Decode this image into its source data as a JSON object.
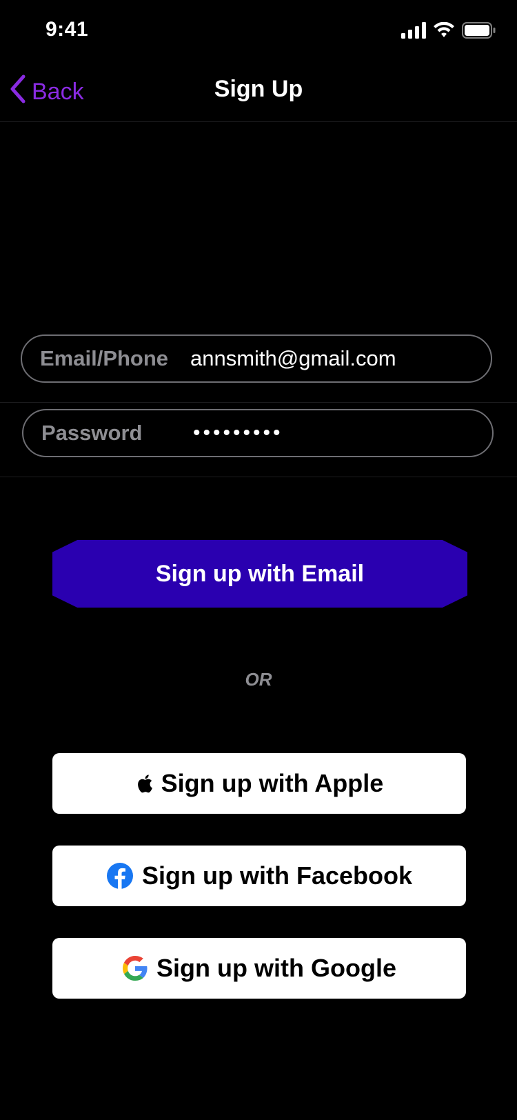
{
  "status_bar": {
    "time": "9:41"
  },
  "nav": {
    "back_label": "Back",
    "title": "Sign Up"
  },
  "form": {
    "email": {
      "label": "Email/Phone",
      "value": "annsmith@gmail.com"
    },
    "password": {
      "label": "Password",
      "value": "•••••••••"
    }
  },
  "buttons": {
    "email_signup": "Sign up with Email",
    "or": "OR",
    "apple": "Sign up with Apple",
    "facebook": "Sign up with Facebook",
    "google": "Sign up with Google"
  },
  "colors": {
    "accent": "#8a2be2",
    "primary_button": "#2a00b0",
    "facebook_blue": "#1877f2"
  },
  "icons": [
    "signal-icon",
    "wifi-icon",
    "battery-icon",
    "chevron-left-icon",
    "apple-icon",
    "facebook-icon",
    "google-icon"
  ]
}
